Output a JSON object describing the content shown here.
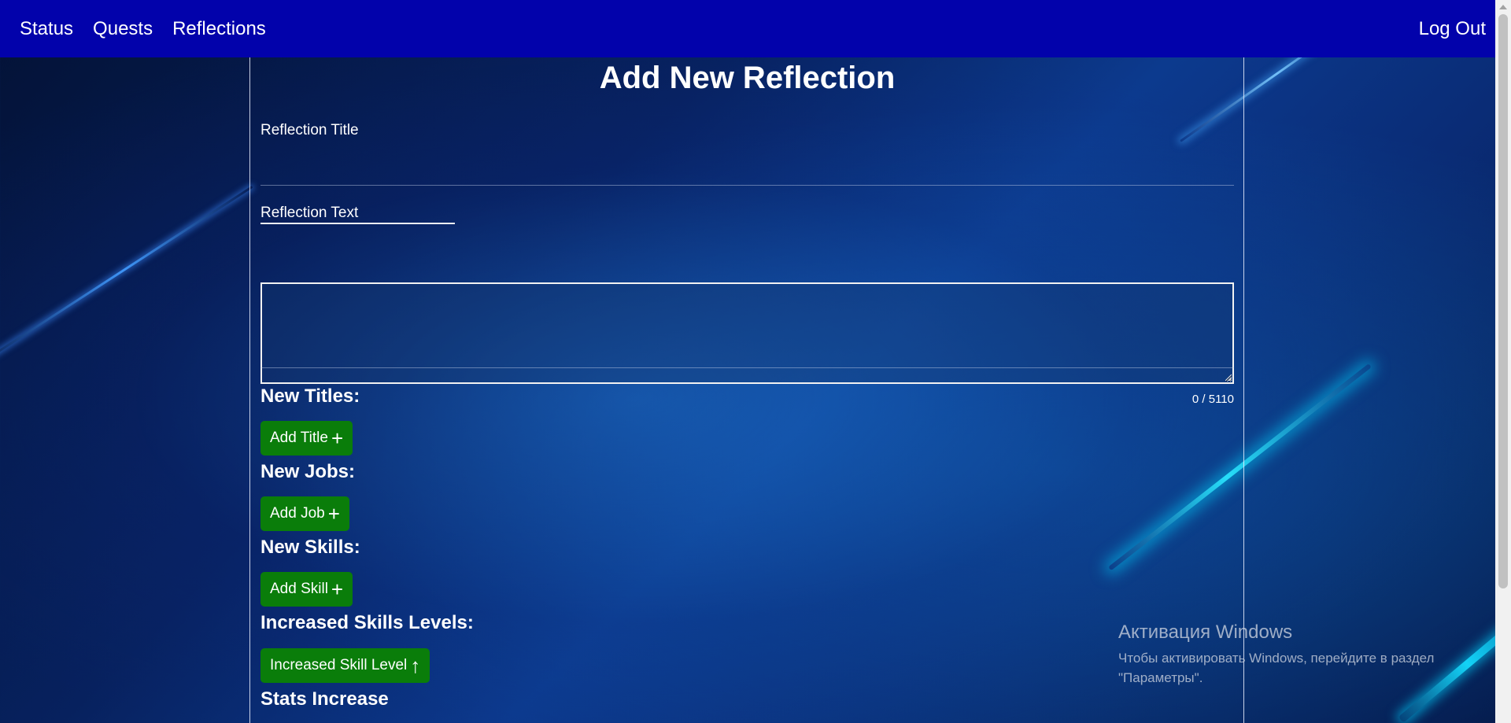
{
  "navbar": {
    "links": [
      "Status",
      "Quests",
      "Reflections"
    ],
    "logout": "Log Out",
    "bg_color": "#0202ab"
  },
  "page": {
    "title": "Add New Reflection"
  },
  "form": {
    "reflection_title_label": "Reflection Title",
    "reflection_title_value": "",
    "reflection_text_label": "Reflection Text",
    "reflection_text_value": "",
    "char_counter": "0 / 5110"
  },
  "sections": {
    "titles": {
      "heading": "New Titles:",
      "button": "Add Title",
      "icon": "plus-icon"
    },
    "jobs": {
      "heading": "New Jobs:",
      "button": "Add Job",
      "icon": "plus-icon"
    },
    "skills": {
      "heading": "New Skills:",
      "button": "Add Skill",
      "icon": "plus-icon"
    },
    "skill_levels": {
      "heading": "Increased Skills Levels:",
      "button": "Increased Skill Level",
      "icon": "arrow-up-icon"
    },
    "stats": {
      "heading": "Stats Increase"
    }
  },
  "colors": {
    "button_green": "#0a7d0a",
    "text": "#ffffff"
  },
  "watermark": {
    "title": "Активация Windows",
    "line1": "Чтобы активировать Windows, перейдите в раздел",
    "line2": "\"Параметры\"."
  }
}
